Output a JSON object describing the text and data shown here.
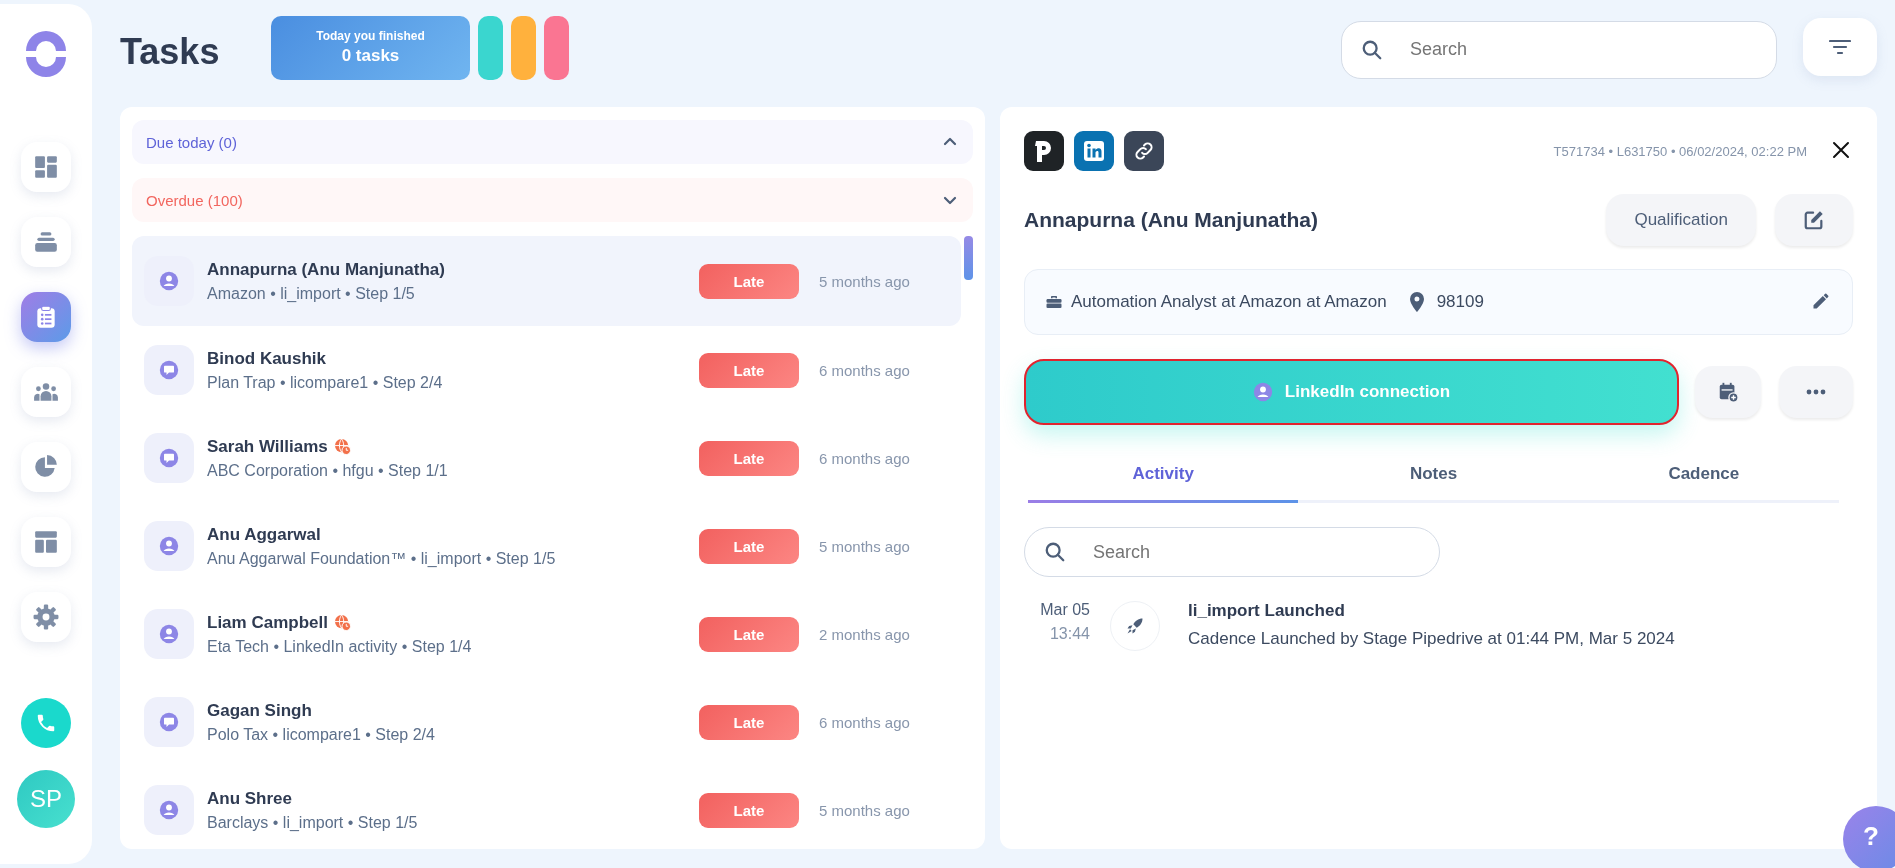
{
  "sidebar": {
    "items": [
      {
        "kind": "dashboard",
        "selected": false
      },
      {
        "kind": "stack",
        "selected": false
      },
      {
        "kind": "tasks",
        "selected": true
      },
      {
        "kind": "people",
        "selected": false
      },
      {
        "kind": "pie",
        "selected": false
      },
      {
        "kind": "layout",
        "selected": false
      },
      {
        "kind": "settings",
        "selected": false
      }
    ],
    "avatar": "SP"
  },
  "header": {
    "title": "Tasks",
    "finished": {
      "caption": "Today you finished",
      "count": "0 tasks"
    },
    "pills": [
      {
        "color": "#3ad6cf"
      },
      {
        "color": "#ffb13d"
      },
      {
        "color": "#fa7592"
      }
    ],
    "search": {
      "placeholder": "Search"
    }
  },
  "sections": [
    {
      "label": "Due today (0)",
      "kind": "due",
      "expanded": true
    },
    {
      "label": "Overdue (100)",
      "kind": "overdue",
      "expanded": false
    }
  ],
  "tasks": [
    {
      "name": "Annapurna (Anu Manjunatha)",
      "details": "Amazon • li_import • Step 1/5",
      "kind": "person",
      "timezone": false,
      "badge": "Late",
      "time": "5 months ago",
      "selected": true
    },
    {
      "name": "Binod Kaushik",
      "details": "Plan Trap • licompare1  • Step 2/4",
      "kind": "chat",
      "timezone": false,
      "badge": "Late",
      "time": "6 months ago",
      "selected": false
    },
    {
      "name": "Sarah Williams",
      "details": "ABC Corporation • hfgu • Step 1/1",
      "kind": "chat",
      "timezone": true,
      "badge": "Late",
      "time": "6 months ago",
      "selected": false
    },
    {
      "name": "Anu Aggarwal",
      "details": "Anu Aggarwal Foundation™ • li_import • Step 1/5",
      "kind": "person",
      "timezone": false,
      "badge": "Late",
      "time": "5 months ago",
      "selected": false
    },
    {
      "name": "Liam Campbell",
      "details": "Eta Tech • LinkedIn activity • Step 1/4",
      "kind": "person",
      "timezone": true,
      "badge": "Late",
      "time": "2 months ago",
      "selected": false
    },
    {
      "name": "Gagan Singh",
      "details": "Polo Tax • licompare1  • Step 2/4",
      "kind": "chat",
      "timezone": false,
      "badge": "Late",
      "time": "6 months ago",
      "selected": false
    },
    {
      "name": "Anu Shree",
      "details": "Barclays • li_import • Step 1/5",
      "kind": "person",
      "timezone": false,
      "badge": "Late",
      "time": "5 months ago",
      "selected": false
    }
  ],
  "detail": {
    "links": [
      {
        "kind": "pipedrive"
      },
      {
        "kind": "linkedin"
      },
      {
        "kind": "link"
      }
    ],
    "meta": "T571734 • L631750 • 06/02/2024, 02:22 PM",
    "name": "Annapurna (Anu Manjunatha)",
    "qualification": "Qualification",
    "job": "Automation Analyst at Amazon at Amazon",
    "zip": "98109",
    "action": {
      "label": "LinkedIn connection",
      "focused": true
    },
    "tabs": [
      {
        "label": "Activity",
        "selected": true
      },
      {
        "label": "Notes",
        "selected": false
      },
      {
        "label": "Cadence",
        "selected": false
      }
    ],
    "search": {
      "placeholder": "Search"
    },
    "activities": [
      {
        "date": "Mar 05",
        "time": "13:44",
        "title": "li_import Launched",
        "description": "Cadence Launched by Stage Pipedrive at 01:44 PM, Mar 5 2024"
      }
    ]
  },
  "help": "?"
}
